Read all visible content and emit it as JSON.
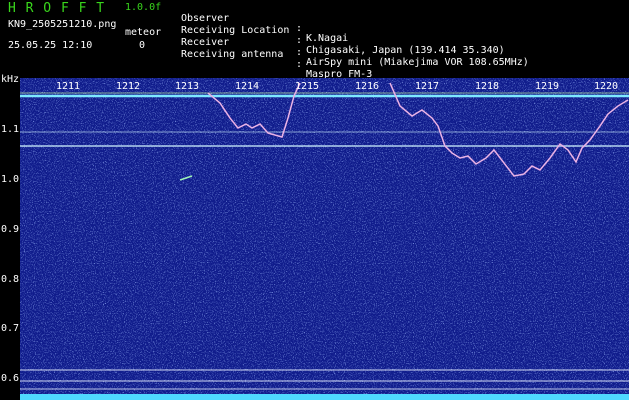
{
  "header": {
    "logo": "H R O F F T",
    "version": "1.0.0f",
    "filename": "KN9_2505251210.png",
    "meteor_label": "meteor",
    "datetime": "25.05.25 12:10",
    "meteor_count": "0",
    "info": [
      {
        "label": "Observer",
        "value": "K.Nagai"
      },
      {
        "label": "Receiving Location",
        "value": "Chigasaki, Japan (139.414 35.340)"
      },
      {
        "label": "Receiver",
        "value": "AirSpy mini (Miakejima VOR 108.65MHz)"
      },
      {
        "label": "Receiving antenna",
        "value": "Maspro FM-3"
      }
    ],
    "separator": ":"
  },
  "axes": {
    "y_unit": "kHz",
    "y_ticks": [
      "1.1",
      "1.0",
      "0.9",
      "0.8",
      "0.7",
      "0.6"
    ],
    "x_ticks": [
      "1211",
      "1212",
      "1213",
      "1214",
      "1215",
      "1216",
      "1217",
      "1218",
      "1219",
      "1220"
    ]
  },
  "colors": {
    "background": "#000000",
    "plot_background": "#101c8c",
    "header_green": "#39d61c",
    "trace": "#d890d8",
    "carrier": "#7de8ff"
  }
}
